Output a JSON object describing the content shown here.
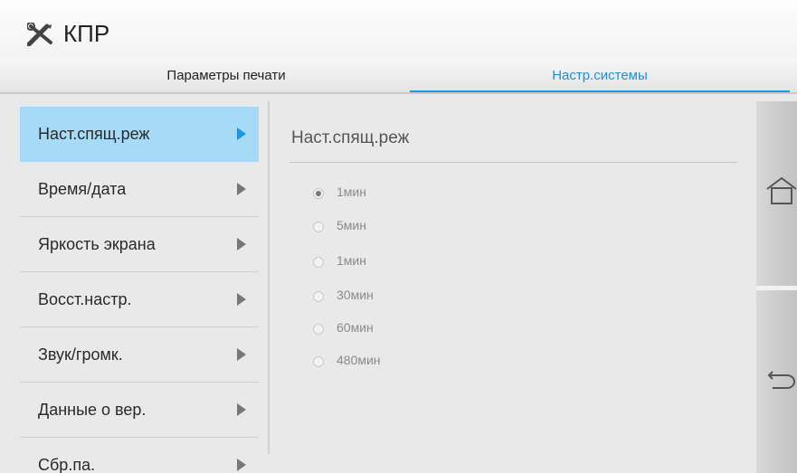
{
  "app": {
    "title": "КПР",
    "title_icon": "tools-icon"
  },
  "tabs": [
    {
      "label": "Параметры печати",
      "active": false
    },
    {
      "label": "Настр.системы",
      "active": true
    }
  ],
  "menu": {
    "items": [
      {
        "label": "Наст.спящ.реж",
        "active": true
      },
      {
        "label": "Время/дата"
      },
      {
        "label": "Яркость экрана"
      },
      {
        "label": "Восст.настр."
      },
      {
        "label": "Звук/громк."
      },
      {
        "label": "Данные о вер."
      },
      {
        "label": "Сбр.па."
      }
    ]
  },
  "panel": {
    "title": "Наст.спящ.реж",
    "options": [
      {
        "label": "1мин",
        "selected": true
      },
      {
        "label": "5мин"
      },
      {
        "label": "1мин"
      },
      {
        "label": "30мин"
      },
      {
        "label": "60мин"
      },
      {
        "label": "480мин"
      }
    ]
  },
  "side": {
    "home_icon": "home-icon",
    "back_icon": "back-icon"
  },
  "colors": {
    "accent": "#1f95dc",
    "active_item_bg": "#a7daf6"
  }
}
